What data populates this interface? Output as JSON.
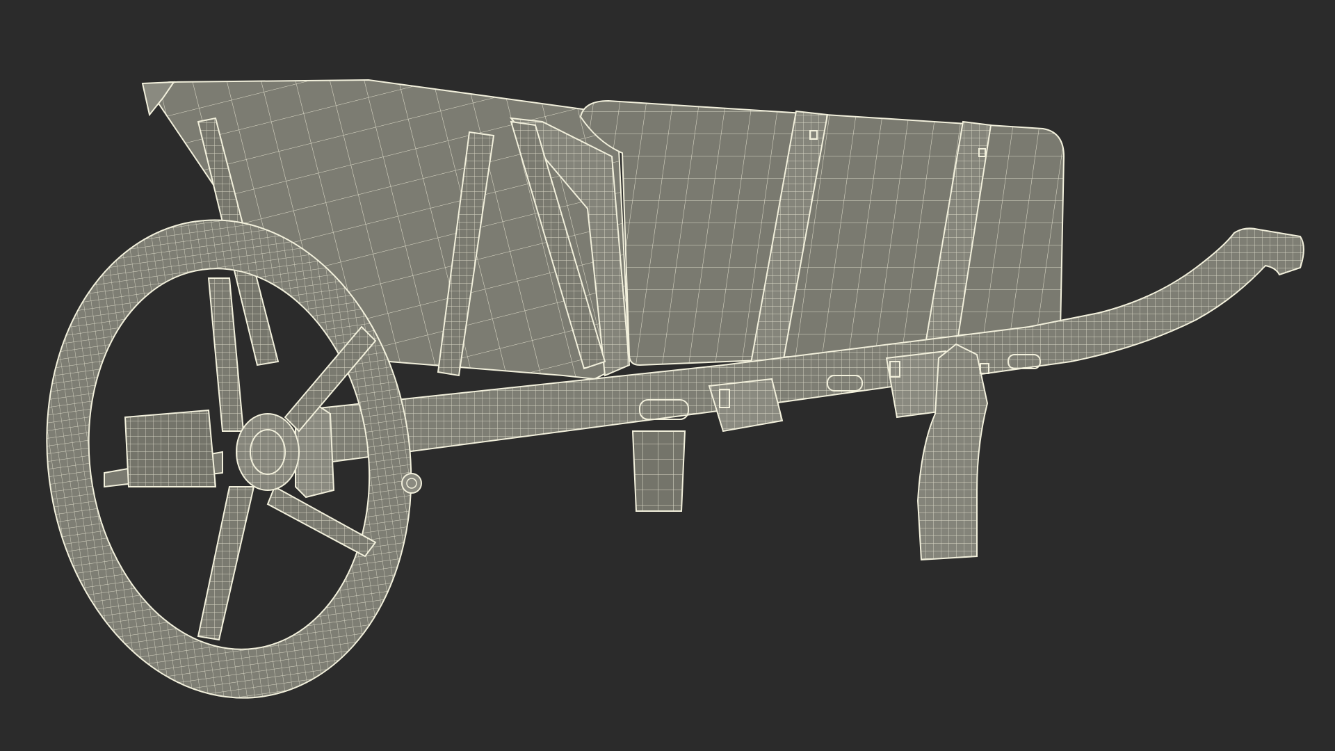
{
  "scene": {
    "subject": "wheelbarrow-wireframe-render",
    "background_color": "#2b2b2b",
    "surface_color": "#7a7a70",
    "surface_shadow_color": "#5e5e56",
    "surface_light_color": "#8c8c82",
    "wire_color": "#f2f0dc"
  }
}
